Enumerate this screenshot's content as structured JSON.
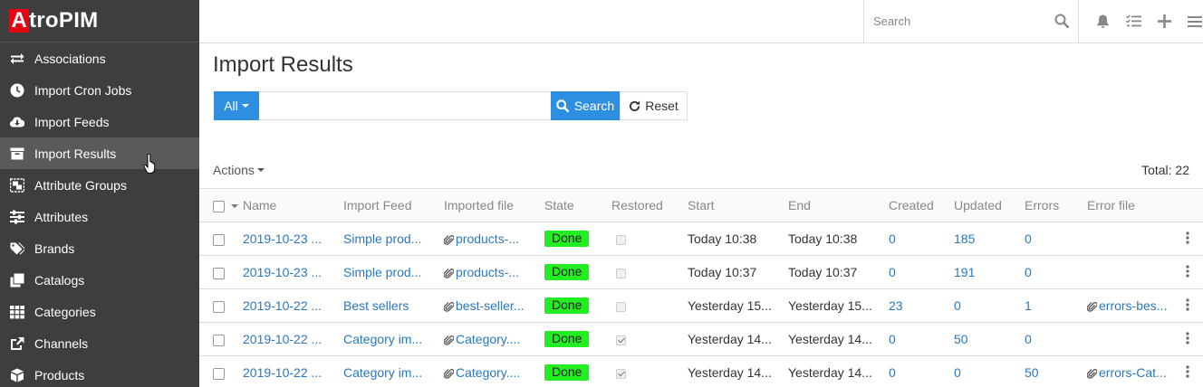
{
  "app": {
    "logo_a": "A",
    "logo_rest": "troPIM"
  },
  "sidebar": {
    "items": [
      {
        "label": "Associations",
        "icon": "exchange-icon"
      },
      {
        "label": "Import Cron Jobs",
        "icon": "clock-icon"
      },
      {
        "label": "Import Feeds",
        "icon": "download-icon"
      },
      {
        "label": "Import Results",
        "icon": "archive-icon",
        "active": true
      },
      {
        "label": "Attribute Groups",
        "icon": "object-group-icon"
      },
      {
        "label": "Attributes",
        "icon": "sliders-icon"
      },
      {
        "label": "Brands",
        "icon": "tags-icon"
      },
      {
        "label": "Catalogs",
        "icon": "clone-icon"
      },
      {
        "label": "Categories",
        "icon": "th-icon"
      },
      {
        "label": "Channels",
        "icon": "share-icon"
      },
      {
        "label": "Products",
        "icon": "boxes-icon"
      }
    ]
  },
  "topbar": {
    "search_placeholder": "Search"
  },
  "page": {
    "title": "Import Results",
    "filter_all": "All",
    "search_button": "Search",
    "reset_button": "Reset",
    "actions": "Actions",
    "total": "Total: 22"
  },
  "table": {
    "columns": [
      "Name",
      "Import Feed",
      "Imported file",
      "State",
      "Restored",
      "Start",
      "End",
      "Created",
      "Updated",
      "Errors",
      "Error file"
    ],
    "rows": [
      {
        "name": "2019-10-23 ...",
        "feed": "Simple prod...",
        "file": "products-...",
        "state": "Done",
        "restored": false,
        "start": "Today 10:38",
        "end": "Today 10:38",
        "created": "0",
        "updated": "185",
        "errors": "0",
        "error_file": ""
      },
      {
        "name": "2019-10-23 ...",
        "feed": "Simple prod...",
        "file": "products-...",
        "state": "Done",
        "restored": false,
        "start": "Today 10:37",
        "end": "Today 10:37",
        "created": "0",
        "updated": "191",
        "errors": "0",
        "error_file": ""
      },
      {
        "name": "2019-10-22 ...",
        "feed": "Best sellers",
        "file": "best-seller...",
        "state": "Done",
        "restored": false,
        "start": "Yesterday 15...",
        "end": "Yesterday 15...",
        "created": "23",
        "updated": "0",
        "errors": "1",
        "error_file": "errors-bes..."
      },
      {
        "name": "2019-10-22 ...",
        "feed": "Category im...",
        "file": "Category....",
        "state": "Done",
        "restored": true,
        "start": "Yesterday 14...",
        "end": "Yesterday 14...",
        "created": "0",
        "updated": "50",
        "errors": "0",
        "error_file": ""
      },
      {
        "name": "2019-10-22 ...",
        "feed": "Category im...",
        "file": "Category....",
        "state": "Done",
        "restored": true,
        "start": "Yesterday 14...",
        "end": "Yesterday 14...",
        "created": "0",
        "updated": "0",
        "errors": "50",
        "error_file": "errors-Cat..."
      }
    ]
  },
  "colors": {
    "sidebar_bg": "#3e3e3e",
    "accent": "#2e8fe0",
    "link": "#2a78bd",
    "done_badge": "#22ee22",
    "logo_red": "#e30613"
  }
}
